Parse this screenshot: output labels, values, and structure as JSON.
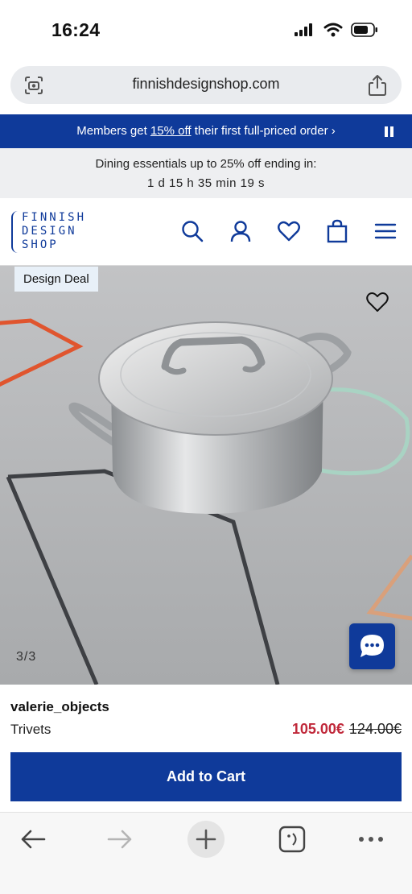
{
  "status": {
    "time": "16:24"
  },
  "browser": {
    "url": "finnishdesignshop.com"
  },
  "promo": {
    "prefix": "Members get ",
    "link": "15% off",
    "suffix": " their first full-priced order ›"
  },
  "countdown": {
    "title": "Dining essentials up to 25% off ending in:",
    "timer": "1 d  15 h  35 min  19 s"
  },
  "logo": {
    "line1": "FINNISH",
    "line2": "DESIGN",
    "line3": "SHOP"
  },
  "product": {
    "badge": "Design Deal",
    "image_counter": "3/3",
    "brand": "valerie_objects",
    "name": "Trivets",
    "sale_price": "105.00€",
    "original_price": "124.00€",
    "add_to_cart": "Add to Cart"
  },
  "colors": {
    "brand_blue": "#0f3a9a",
    "sale_red": "#c0283a"
  },
  "icons": [
    "search-icon",
    "account-icon",
    "heart-icon",
    "bag-icon",
    "menu-icon",
    "chat-icon",
    "share-icon",
    "camera-search-icon"
  ]
}
